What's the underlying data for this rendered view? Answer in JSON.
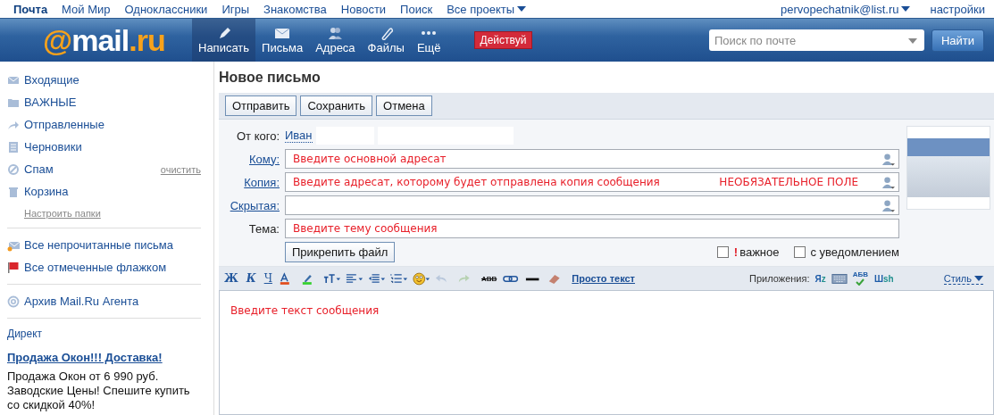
{
  "top_links": [
    {
      "label": "Почта",
      "selected": true
    },
    {
      "label": "Мой Мир",
      "selected": false
    },
    {
      "label": "Одноклассники",
      "selected": false
    },
    {
      "label": "Игры",
      "selected": false
    },
    {
      "label": "Знакомства",
      "selected": false
    },
    {
      "label": "Новости",
      "selected": false
    },
    {
      "label": "Поиск",
      "selected": false
    },
    {
      "label": "Все проекты",
      "selected": false,
      "dropdown": true
    }
  ],
  "account": {
    "email": "pervopechatnik@list.ru",
    "settings": "настройки"
  },
  "logo": [
    {
      "text": "@",
      "color": "#f7a21b"
    },
    {
      "text": "mail",
      "color": "#ffffff"
    },
    {
      "text": ".ru",
      "color": "#f7a21b"
    }
  ],
  "nav": [
    {
      "label": "Написать",
      "kind": "pencil",
      "selected": true
    },
    {
      "label": "Письма",
      "kind": "envelope",
      "selected": false
    },
    {
      "label": "Адреса",
      "kind": "people",
      "selected": false
    },
    {
      "label": "Файлы",
      "kind": "clip",
      "selected": false
    },
    {
      "label": "Ещё",
      "kind": "dots",
      "selected": false
    }
  ],
  "promo_button": "Действуй",
  "search": {
    "placeholder": "Поиск по почте",
    "button": "Найти"
  },
  "folders": [
    {
      "label": "Входящие",
      "kind": "envelope"
    },
    {
      "label": "ВАЖНЫЕ",
      "kind": "folder"
    },
    {
      "label": "Отправленные",
      "kind": "arrow"
    },
    {
      "label": "Черновики",
      "kind": "doc"
    },
    {
      "label": "Спам",
      "kind": "spam",
      "action": "очистить"
    },
    {
      "label": "Корзина",
      "kind": "trash"
    }
  ],
  "configure_folders": "Настроить папки",
  "filters": [
    {
      "label": "Все непрочитанные письма",
      "kind": "unread"
    },
    {
      "label": "Все отмеченные флажком",
      "kind": "flag"
    }
  ],
  "agent_archive": "Архив Mail.Ru Агента",
  "ad": {
    "section": "Директ",
    "title": "Продажа Окон!!! Доставка!",
    "text": "Продажа Окон от 6 990 руб. Заводские Цены! Спешите купить со скидкой 40%!"
  },
  "page_title": "Новое письмо",
  "actions": [
    "Отправить",
    "Сохранить",
    "Отмена"
  ],
  "fields": [
    {
      "kind": "from",
      "label": "От кого:",
      "value": "Иван"
    },
    {
      "kind": "address",
      "label": "Кому:",
      "value": "Введите основной адресат"
    },
    {
      "kind": "address",
      "label": "Копия:",
      "value": "Введите адресат, которому будет отправлена копия сообщения",
      "note": "НЕОБЯЗАТЕЛЬНОЕ ПОЛЕ"
    },
    {
      "kind": "address",
      "label": "Скрытая:"
    },
    {
      "kind": "subject",
      "label": "Тема:",
      "value": "Введите тему сообщения"
    }
  ],
  "attach_button": "Прикрепить файл",
  "options": [
    {
      "label": "важное",
      "mark": "!",
      "checked": false
    },
    {
      "label": "с уведомлением",
      "checked": false
    }
  ],
  "toolbar": [
    {
      "kind": "bold",
      "label": "Ж"
    },
    {
      "kind": "italic",
      "label": "К"
    },
    {
      "kind": "underline",
      "label": "Ч"
    },
    {
      "kind": "textcolor"
    },
    {
      "kind": "highlight"
    },
    {
      "kind": "fontsize"
    },
    {
      "kind": "align"
    },
    {
      "kind": "indent"
    },
    {
      "kind": "list"
    },
    {
      "kind": "smiley"
    },
    {
      "kind": "undo"
    },
    {
      "kind": "redo"
    },
    {
      "kind": "strike",
      "label": "ABB"
    },
    {
      "kind": "link"
    },
    {
      "kind": "rule"
    },
    {
      "kind": "eraser"
    },
    {
      "kind": "plain",
      "label": "Просто текст"
    }
  ],
  "apps_label": "Приложения:",
  "apps": [
    {
      "kind": "translate",
      "label": "Я",
      "sub": "z"
    },
    {
      "kind": "keyboard"
    },
    {
      "kind": "spell",
      "label": "АБВ"
    },
    {
      "kind": "translit",
      "label": "Ш",
      "sub": "sh"
    }
  ],
  "style_menu": "Стиль",
  "body": {
    "value": "Введите текст сообщения"
  }
}
